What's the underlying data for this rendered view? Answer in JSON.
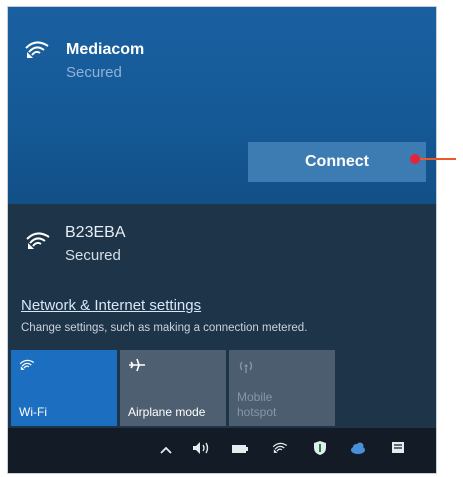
{
  "selected_network": {
    "name": "Mediacom",
    "status": "Secured",
    "connect_label": "Connect"
  },
  "other_network": {
    "name": "B23EBA",
    "status": "Secured"
  },
  "settings": {
    "link_text": "Network & Internet settings",
    "description": "Change settings, such as making a connection metered."
  },
  "quick_actions": {
    "wifi": {
      "label": "Wi-Fi"
    },
    "airplane": {
      "label": "Airplane mode"
    },
    "hotspot": {
      "label_line1": "Mobile",
      "label_line2": "hotspot"
    }
  },
  "taskbar": {
    "icons": [
      "chevron-up-icon",
      "volume-icon",
      "battery-icon",
      "wifi-icon",
      "defender-icon",
      "cloud-icon",
      "notifications-icon"
    ]
  },
  "colors": {
    "selected_bg": "#155a97",
    "connect_button": "#3d7cb3",
    "callout_red": "#e5243b",
    "callout_line": "#e85a2a"
  }
}
